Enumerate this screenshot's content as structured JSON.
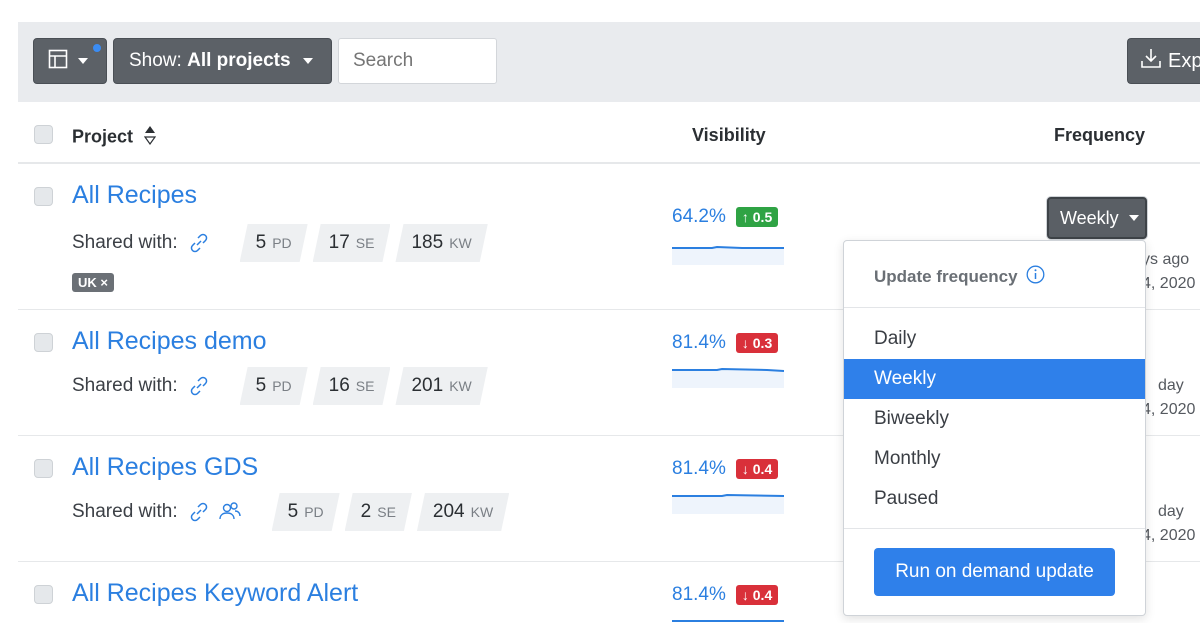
{
  "toolbar": {
    "show_prefix": "Show:",
    "show_value": "All projects",
    "search_placeholder": "Search",
    "export_label": "Exp"
  },
  "columns": {
    "project": "Project",
    "visibility": "Visibility",
    "frequency": "Frequency"
  },
  "projects": [
    {
      "name": "All Recipes",
      "shared_label": "Shared with:",
      "pd": "5",
      "se": "17",
      "kw": "185",
      "tag": "UK ×",
      "visibility": "64.2%",
      "change": "↑ 0.5",
      "change_dir": "up",
      "updated_1": "ys ago",
      "updated_2": "4, 2020"
    },
    {
      "name": "All Recipes demo",
      "shared_label": "Shared with:",
      "pd": "5",
      "se": "16",
      "kw": "201",
      "visibility": "81.4%",
      "change": "↓ 0.3",
      "change_dir": "down",
      "updated_1": "day",
      "updated_2": "4, 2020"
    },
    {
      "name": "All Recipes GDS",
      "shared_label": "Shared with:",
      "pd": "5",
      "se": "2",
      "kw": "204",
      "visibility": "81.4%",
      "change": "↓ 0.4",
      "change_dir": "down",
      "updated_1": "day",
      "updated_2": "4, 2020"
    },
    {
      "name": "All Recipes Keyword Alert",
      "visibility": "81.4%",
      "change": "↓ 0.4",
      "change_dir": "down"
    }
  ],
  "units": {
    "pd": "PD",
    "se": "SE",
    "kw": "KW"
  },
  "frequency_button": "Weekly",
  "dropdown": {
    "title": "Update frequency",
    "options": [
      "Daily",
      "Weekly",
      "Biweekly",
      "Monthly",
      "Paused"
    ],
    "selected": "Weekly",
    "action": "Run on demand update"
  },
  "colors": {
    "accent": "#2f80ea",
    "link": "#2b7fe0",
    "up": "#2fa344",
    "down": "#d9303a"
  }
}
